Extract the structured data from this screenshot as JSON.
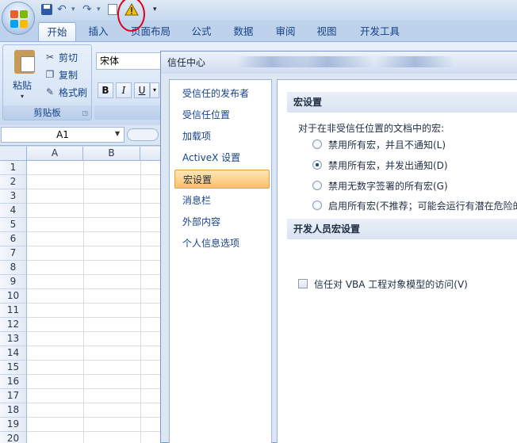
{
  "quick_access": {
    "office_button": "office-logo",
    "save": "save-icon",
    "undo": "undo-icon",
    "redo": "redo-icon",
    "warning": "warning-icon",
    "warning_color": "#f2c200",
    "annotation_color": "#e0001a"
  },
  "tabs": [
    {
      "label": "开始",
      "active": true
    },
    {
      "label": "插入"
    },
    {
      "label": "页面布局"
    },
    {
      "label": "公式"
    },
    {
      "label": "数据"
    },
    {
      "label": "审阅"
    },
    {
      "label": "视图"
    },
    {
      "label": "开发工具"
    }
  ],
  "ribbon": {
    "clipboard": {
      "paste": "粘贴",
      "cut": "剪切",
      "copy": "复制",
      "format_painter": "格式刷",
      "group_label": "剪贴板"
    },
    "font": {
      "font_name": "宋体",
      "bold": "B",
      "italic": "I",
      "underline": "U"
    }
  },
  "formula_bar": {
    "name_box": "A1"
  },
  "sheet": {
    "columns": [
      "A",
      "B"
    ],
    "rows": [
      "1",
      "2",
      "3",
      "4",
      "5",
      "6",
      "7",
      "8",
      "9",
      "10",
      "11",
      "12",
      "13",
      "14",
      "15",
      "16",
      "17",
      "18",
      "19",
      "20"
    ]
  },
  "dialog": {
    "title": "信任中心",
    "nav_items": [
      {
        "label": "受信任的发布者"
      },
      {
        "label": "受信任位置"
      },
      {
        "label": "加载项"
      },
      {
        "label": "ActiveX 设置"
      },
      {
        "label": "宏设置",
        "active": true
      },
      {
        "label": "消息栏"
      },
      {
        "label": "外部内容"
      },
      {
        "label": "个人信息选项"
      }
    ],
    "macro_section_title": "宏设置",
    "macro_intro": "对于在非受信任位置的文档中的宏:",
    "macro_options": [
      {
        "label": "禁用所有宏，并且不通知(L)"
      },
      {
        "label": "禁用所有宏，并发出通知(D)",
        "selected": true
      },
      {
        "label": "禁用无数字签署的所有宏(G)"
      },
      {
        "label": "启用所有宏(不推荐；可能会运行有潜在危险的"
      }
    ],
    "dev_section_title": "开发人员宏设置",
    "vba_checkbox": "信任对 VBA 工程对象模型的访问(V)"
  }
}
